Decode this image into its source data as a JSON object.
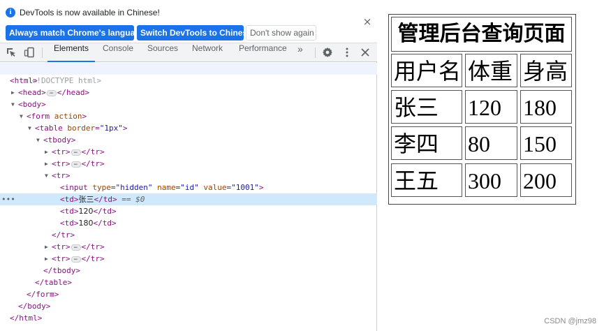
{
  "infobar": {
    "icon": "info-icon",
    "message": "DevTools is now available in Chinese!",
    "btn_match": "Always match Chrome's language",
    "btn_switch": "Switch DevTools to Chinese",
    "btn_dont": "Don't show again",
    "close": "×"
  },
  "toolbar": {
    "tabs": [
      "Elements",
      "Console",
      "Sources",
      "Network",
      "Performance"
    ],
    "more": "»",
    "icons": [
      "inspect-icon",
      "device-toolbar-icon",
      "settings-icon",
      "kebab-menu-icon",
      "close-icon"
    ]
  },
  "dom": {
    "doctype": "<!DOCTYPE html>",
    "html": "html",
    "head": "head",
    "body": "body",
    "form": "form",
    "form_attr": "action",
    "table": "table",
    "table_attr": "border",
    "table_attr_val": "\"1px\"",
    "tbody": "tbody",
    "tr": "tr",
    "input": "input",
    "input_type_attr": "type",
    "input_type_val": "\"hidden\"",
    "input_name_attr": "name",
    "input_name_val": "\"id\"",
    "input_value_attr": "value",
    "input_value_val": "\"1001\"",
    "td": "td",
    "td1_text": "张三",
    "td2_text": "120",
    "td3_text": "180",
    "selected_marker": "== $0",
    "row_dots": "•••"
  },
  "page": {
    "table_title": "管理后台查询页面",
    "headers": [
      "用户名",
      "体重",
      "身高"
    ],
    "rows": [
      [
        "张三",
        "120",
        "180"
      ],
      [
        "李四",
        "80",
        "150"
      ],
      [
        "王五",
        "300",
        "200"
      ]
    ]
  },
  "watermark": "CSDN @jmz98",
  "colors": {
    "accent": "#1a73e8",
    "selected_row": "#cfe8fc",
    "tag": "#881280",
    "attr": "#994500",
    "value": "#1a1aa6"
  }
}
